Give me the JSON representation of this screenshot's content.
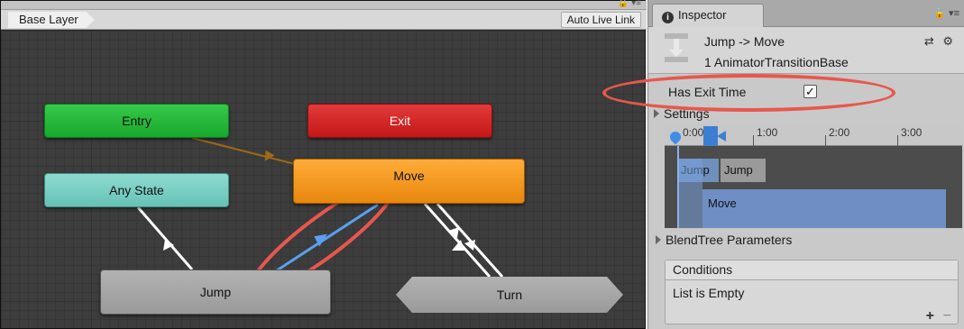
{
  "animator": {
    "breadcrumb": "Base Layer",
    "auto_live_link": "Auto Live Link",
    "tab_icons": "🔒 ▾≡",
    "states": {
      "entry": "Entry",
      "exit": "Exit",
      "any_state": "Any State",
      "move": "Move",
      "jump": "Jump",
      "turn": "Turn"
    }
  },
  "inspector": {
    "tab_label": "Inspector",
    "tab_icon": "info-icon",
    "tab_icons": "🔒 ▾≡",
    "title": "Jump -> Move",
    "subtitle": "1 AnimatorTransitionBase",
    "header_icons": "⇄ ⚙",
    "has_exit_time_label": "Has Exit Time",
    "has_exit_time_checked": true,
    "settings_label": "Settings",
    "timeline": {
      "ticks": [
        "0:00",
        "1:00",
        "2:00",
        "3:00"
      ],
      "jump_label_1": "Jump",
      "jump_label_2": "Jump",
      "move_label": "Move"
    },
    "blendtree_label": "BlendTree Parameters",
    "conditions": {
      "header": "Conditions",
      "empty_text": "List is Empty",
      "add_label": "+",
      "remove_label": "−"
    }
  },
  "colors": {
    "entry": "#1fb535",
    "exit": "#d22828",
    "any_state": "#7ccfc4",
    "move": "#f59a1f",
    "default_state": "#a8a8a8",
    "selected_transition": "#5aa0f0",
    "annotation": "#e8574d"
  }
}
